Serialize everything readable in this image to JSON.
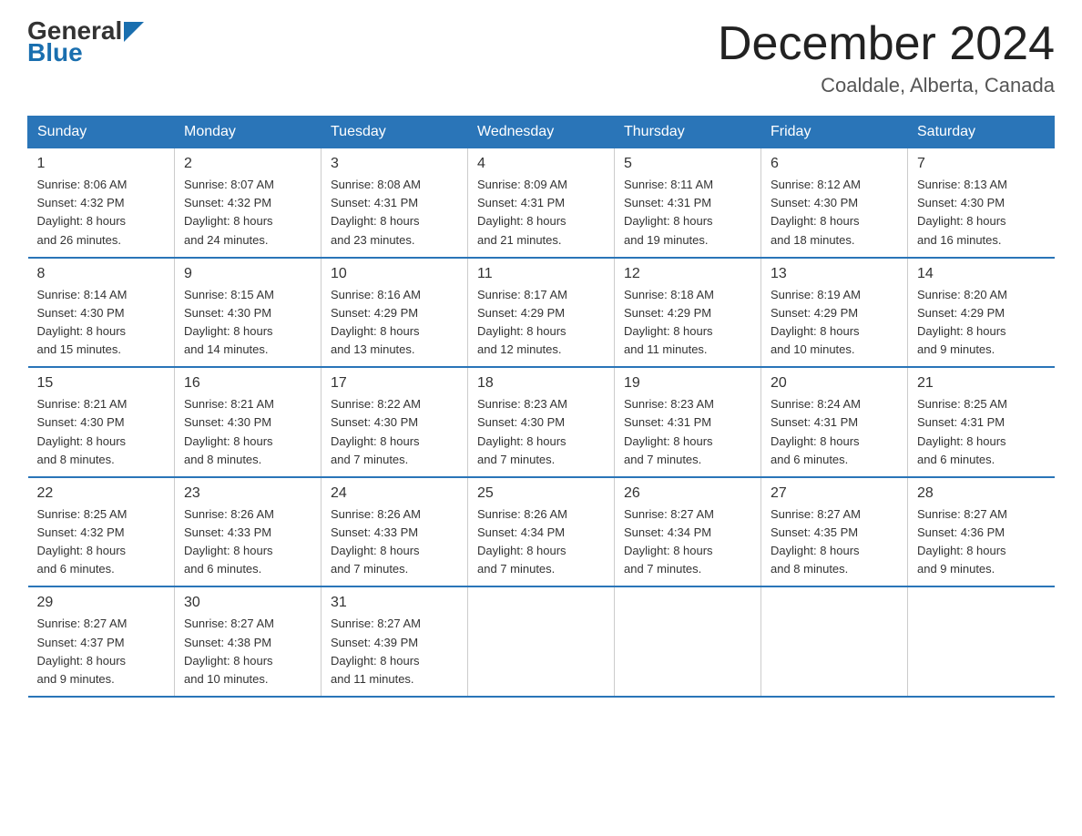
{
  "header": {
    "logo_general": "General",
    "logo_blue": "Blue",
    "month_title": "December 2024",
    "location": "Coaldale, Alberta, Canada"
  },
  "days_of_week": [
    "Sunday",
    "Monday",
    "Tuesday",
    "Wednesday",
    "Thursday",
    "Friday",
    "Saturday"
  ],
  "weeks": [
    [
      {
        "day": "1",
        "info": "Sunrise: 8:06 AM\nSunset: 4:32 PM\nDaylight: 8 hours\nand 26 minutes."
      },
      {
        "day": "2",
        "info": "Sunrise: 8:07 AM\nSunset: 4:32 PM\nDaylight: 8 hours\nand 24 minutes."
      },
      {
        "day": "3",
        "info": "Sunrise: 8:08 AM\nSunset: 4:31 PM\nDaylight: 8 hours\nand 23 minutes."
      },
      {
        "day": "4",
        "info": "Sunrise: 8:09 AM\nSunset: 4:31 PM\nDaylight: 8 hours\nand 21 minutes."
      },
      {
        "day": "5",
        "info": "Sunrise: 8:11 AM\nSunset: 4:31 PM\nDaylight: 8 hours\nand 19 minutes."
      },
      {
        "day": "6",
        "info": "Sunrise: 8:12 AM\nSunset: 4:30 PM\nDaylight: 8 hours\nand 18 minutes."
      },
      {
        "day": "7",
        "info": "Sunrise: 8:13 AM\nSunset: 4:30 PM\nDaylight: 8 hours\nand 16 minutes."
      }
    ],
    [
      {
        "day": "8",
        "info": "Sunrise: 8:14 AM\nSunset: 4:30 PM\nDaylight: 8 hours\nand 15 minutes."
      },
      {
        "day": "9",
        "info": "Sunrise: 8:15 AM\nSunset: 4:30 PM\nDaylight: 8 hours\nand 14 minutes."
      },
      {
        "day": "10",
        "info": "Sunrise: 8:16 AM\nSunset: 4:29 PM\nDaylight: 8 hours\nand 13 minutes."
      },
      {
        "day": "11",
        "info": "Sunrise: 8:17 AM\nSunset: 4:29 PM\nDaylight: 8 hours\nand 12 minutes."
      },
      {
        "day": "12",
        "info": "Sunrise: 8:18 AM\nSunset: 4:29 PM\nDaylight: 8 hours\nand 11 minutes."
      },
      {
        "day": "13",
        "info": "Sunrise: 8:19 AM\nSunset: 4:29 PM\nDaylight: 8 hours\nand 10 minutes."
      },
      {
        "day": "14",
        "info": "Sunrise: 8:20 AM\nSunset: 4:29 PM\nDaylight: 8 hours\nand 9 minutes."
      }
    ],
    [
      {
        "day": "15",
        "info": "Sunrise: 8:21 AM\nSunset: 4:30 PM\nDaylight: 8 hours\nand 8 minutes."
      },
      {
        "day": "16",
        "info": "Sunrise: 8:21 AM\nSunset: 4:30 PM\nDaylight: 8 hours\nand 8 minutes."
      },
      {
        "day": "17",
        "info": "Sunrise: 8:22 AM\nSunset: 4:30 PM\nDaylight: 8 hours\nand 7 minutes."
      },
      {
        "day": "18",
        "info": "Sunrise: 8:23 AM\nSunset: 4:30 PM\nDaylight: 8 hours\nand 7 minutes."
      },
      {
        "day": "19",
        "info": "Sunrise: 8:23 AM\nSunset: 4:31 PM\nDaylight: 8 hours\nand 7 minutes."
      },
      {
        "day": "20",
        "info": "Sunrise: 8:24 AM\nSunset: 4:31 PM\nDaylight: 8 hours\nand 6 minutes."
      },
      {
        "day": "21",
        "info": "Sunrise: 8:25 AM\nSunset: 4:31 PM\nDaylight: 8 hours\nand 6 minutes."
      }
    ],
    [
      {
        "day": "22",
        "info": "Sunrise: 8:25 AM\nSunset: 4:32 PM\nDaylight: 8 hours\nand 6 minutes."
      },
      {
        "day": "23",
        "info": "Sunrise: 8:26 AM\nSunset: 4:33 PM\nDaylight: 8 hours\nand 6 minutes."
      },
      {
        "day": "24",
        "info": "Sunrise: 8:26 AM\nSunset: 4:33 PM\nDaylight: 8 hours\nand 7 minutes."
      },
      {
        "day": "25",
        "info": "Sunrise: 8:26 AM\nSunset: 4:34 PM\nDaylight: 8 hours\nand 7 minutes."
      },
      {
        "day": "26",
        "info": "Sunrise: 8:27 AM\nSunset: 4:34 PM\nDaylight: 8 hours\nand 7 minutes."
      },
      {
        "day": "27",
        "info": "Sunrise: 8:27 AM\nSunset: 4:35 PM\nDaylight: 8 hours\nand 8 minutes."
      },
      {
        "day": "28",
        "info": "Sunrise: 8:27 AM\nSunset: 4:36 PM\nDaylight: 8 hours\nand 9 minutes."
      }
    ],
    [
      {
        "day": "29",
        "info": "Sunrise: 8:27 AM\nSunset: 4:37 PM\nDaylight: 8 hours\nand 9 minutes."
      },
      {
        "day": "30",
        "info": "Sunrise: 8:27 AM\nSunset: 4:38 PM\nDaylight: 8 hours\nand 10 minutes."
      },
      {
        "day": "31",
        "info": "Sunrise: 8:27 AM\nSunset: 4:39 PM\nDaylight: 8 hours\nand 11 minutes."
      },
      null,
      null,
      null,
      null
    ]
  ]
}
